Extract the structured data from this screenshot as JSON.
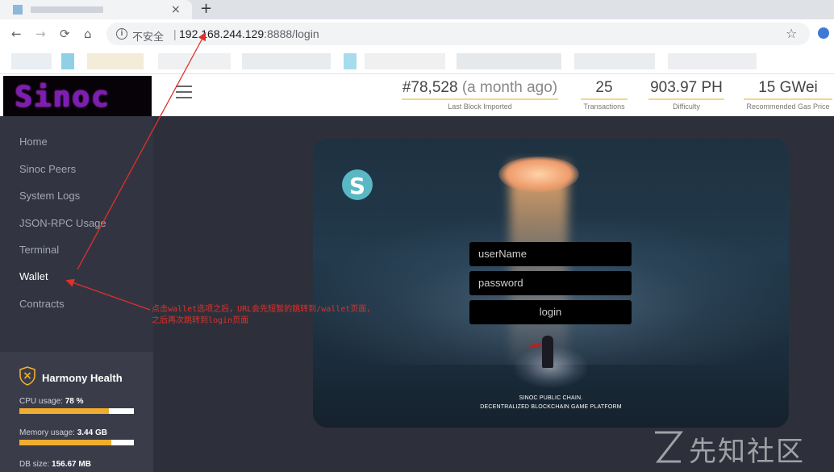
{
  "browser": {
    "tab_close": "×",
    "new_tab": "+",
    "nav": {
      "back": "←",
      "forward": "→",
      "reload": "⟳",
      "home": "⌂"
    },
    "info_glyph": "i",
    "insecure_label": "不安全",
    "separator": "|",
    "url_host": "192.168.244.129",
    "url_path": ":8888/login",
    "star": "☆"
  },
  "header": {
    "logo_text": "Sinoc",
    "stats": [
      {
        "value": "#78,528",
        "suffix": " (a month ago)",
        "label": "Last Block Imported"
      },
      {
        "value": "25",
        "label": "Transactions"
      },
      {
        "value": "903.97 PH",
        "label": "Difficulty"
      },
      {
        "value": "15 GWei",
        "label": "Recommended Gas Price"
      }
    ]
  },
  "sidebar": {
    "items": [
      {
        "label": "Home"
      },
      {
        "label": "Sinoc Peers"
      },
      {
        "label": "System Logs"
      },
      {
        "label": "JSON-RPC Usage"
      },
      {
        "label": "Terminal"
      },
      {
        "label": "Wallet",
        "active": true
      },
      {
        "label": "Contracts"
      }
    ],
    "health": {
      "title": "Harmony Health",
      "cpu_label": "CPU usage:",
      "cpu_value": "78 %",
      "cpu_fraction": 0.78,
      "memory_label": "Memory usage:",
      "memory_value": "3.44 GB",
      "memory_fraction": 0.8,
      "db_label": "DB size:",
      "db_value": "156.67 MB"
    }
  },
  "login": {
    "username_placeholder": "userName",
    "password_placeholder": "password",
    "button_label": "login",
    "logo_letter": "S",
    "tagline_line1": "SINOC PUBLIC CHAIN.",
    "tagline_line2": "DECENTRALIZED BLOCKCHAIN GAME PLATFORM"
  },
  "annotation": {
    "line1": "点击wallet选项之后，URL会先短暂的跳转到/wallet页面，",
    "line2": "之后再次跳转到login页面",
    "color": "#e0302a"
  },
  "watermark": {
    "text": "先知社区"
  },
  "colors": {
    "accent_bar": "#f0ad2e",
    "sidebar_bg": "#323541",
    "main_bg": "#2d303b"
  }
}
